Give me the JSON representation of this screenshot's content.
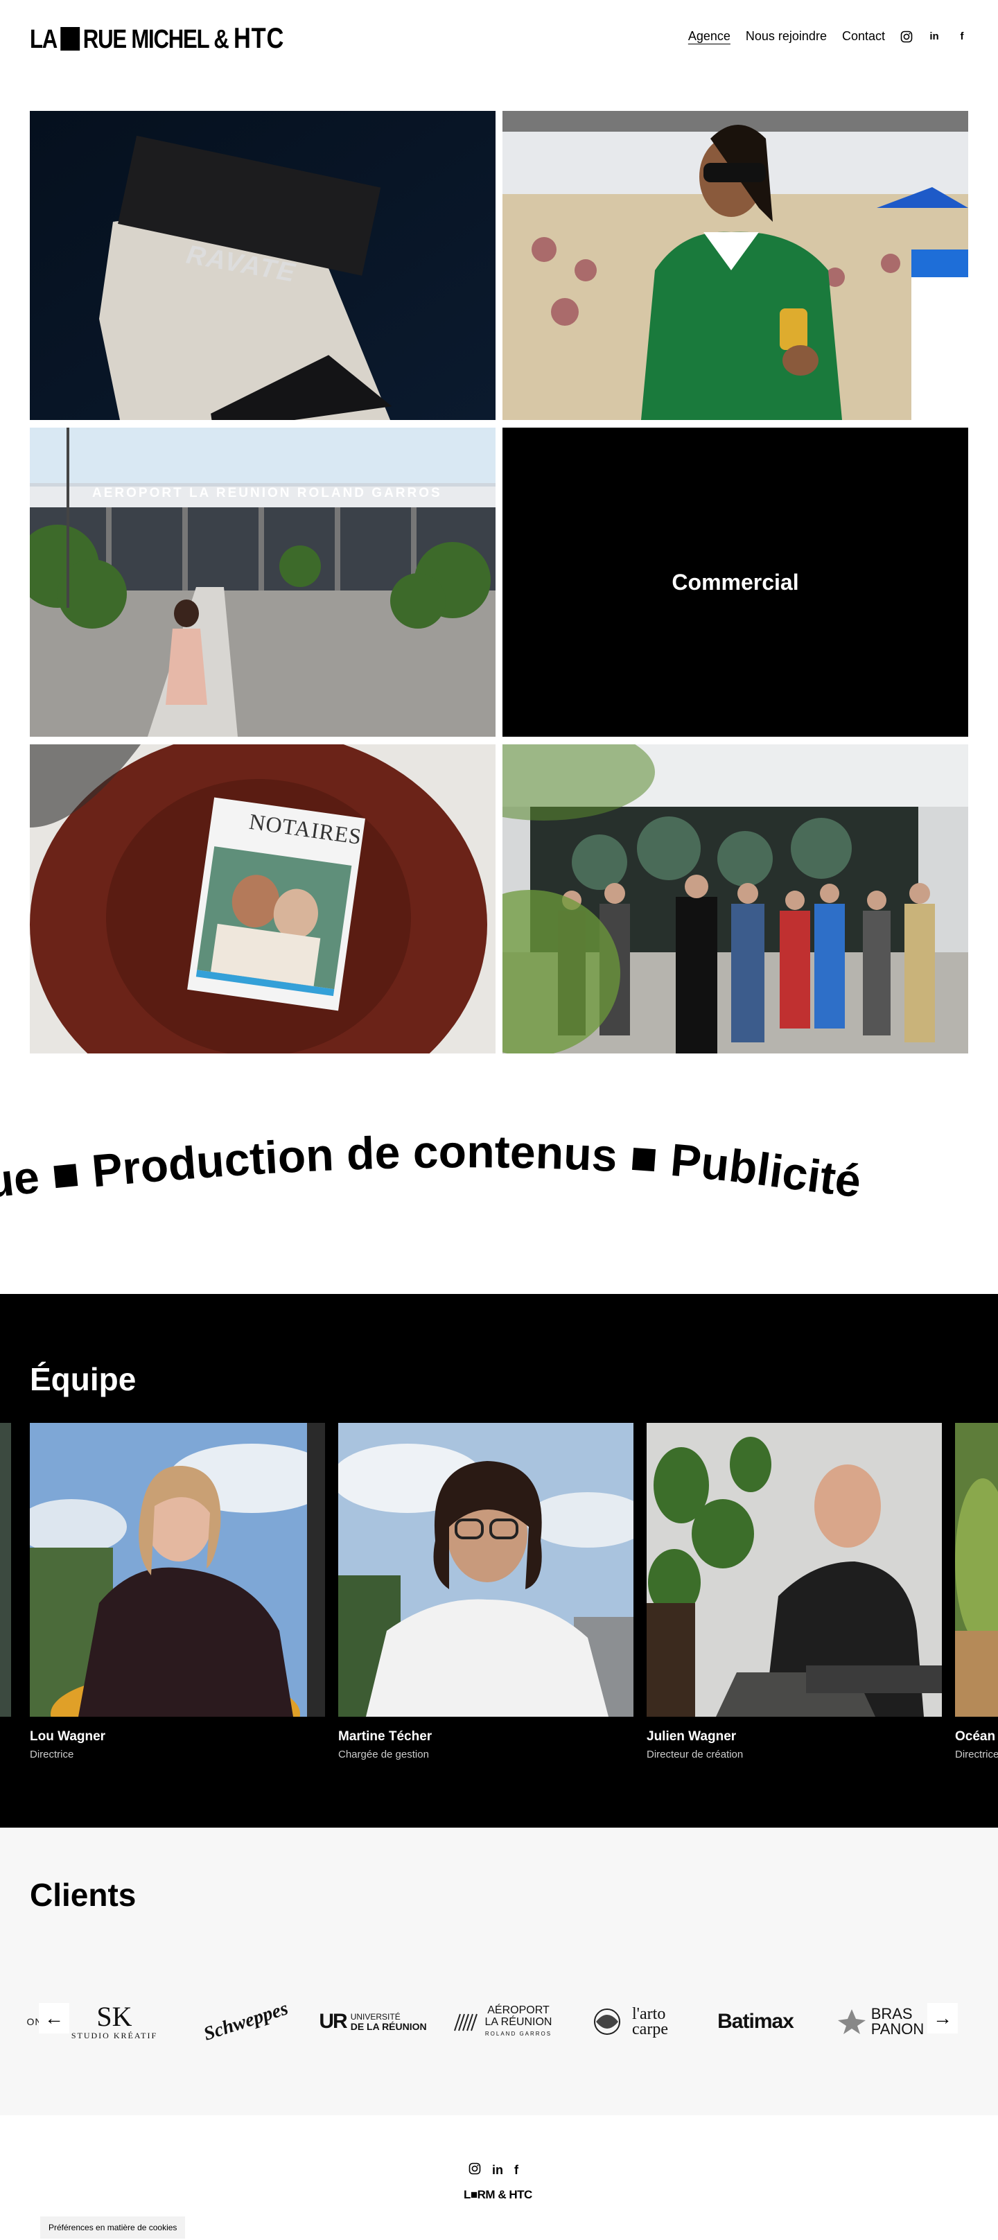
{
  "header": {
    "logo_pre": "LA",
    "logo_mid": "RUE MICHEL &",
    "logo_htc": "HTC",
    "nav": [
      "Agence",
      "Nous rejoindre",
      "Contact"
    ],
    "social": [
      "instagram-icon",
      "linkedin-icon",
      "facebook-icon"
    ]
  },
  "gallery": {
    "tile1_card_text": "RAVATE",
    "tile3_sign": "AEROPORT LA REUNION ROLAND GARROS",
    "tile4_label": "Commercial",
    "tile5_magazine": "NOTAIRES"
  },
  "marquee": {
    "text": "arque  ■  Production de contenus  ■  Publicité"
  },
  "team": {
    "title": "Équipe",
    "members": [
      {
        "name": "Lou Wagner",
        "role": "Directrice"
      },
      {
        "name": "Martine Técher",
        "role": "Chargée de gestion"
      },
      {
        "name": "Julien Wagner",
        "role": "Directeur de création"
      },
      {
        "name": "Océan",
        "role": "Directrice"
      }
    ]
  },
  "clients": {
    "title": "Clients",
    "prev": "←",
    "next": "→",
    "logos": [
      {
        "main": "SK",
        "sub": "STUDIO KRÉATIF"
      },
      {
        "main": "Schweppes",
        "sub": ""
      },
      {
        "main": "UNIVERSITÉ",
        "sub": "DE LA RÉUNION"
      },
      {
        "main": "AÉROPORT",
        "sub": "LA RÉUNION"
      },
      {
        "main": "l'arto",
        "sub": "carpe"
      },
      {
        "main": "Batimax",
        "sub": ""
      },
      {
        "main": "BRAS",
        "sub": "PANON"
      }
    ],
    "logo_ur": "UR",
    "logo_airport_extra": "ROLAND GARROS",
    "edge_left": "ON"
  },
  "footer": {
    "logo": "L■RM & HTC",
    "cookie": "Préférences en matière de cookies"
  }
}
